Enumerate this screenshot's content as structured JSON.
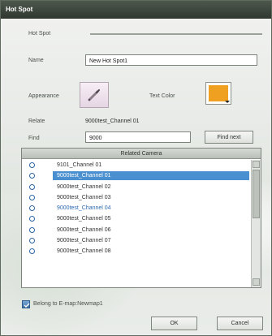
{
  "window": {
    "title": "Hot Spot"
  },
  "form": {
    "hotspot_label": "Hot Spot",
    "name_label": "Name",
    "name_value": "New Hot Spot1",
    "appearance_label": "Appearance",
    "text_color_label": "Text Color",
    "text_color": "#f0a020",
    "relate_label": "Relate",
    "relate_value": "9000test_Channel 01",
    "find_label": "Find",
    "find_value": "9000",
    "find_next_label": "Find next"
  },
  "camera_list": {
    "header": "Related Camera",
    "items": [
      {
        "label": "9101_Channel 01",
        "selected": false,
        "highlighted": false
      },
      {
        "label": "9000test_Channel 01",
        "selected": true,
        "highlighted": false
      },
      {
        "label": "9000test_Channel 02",
        "selected": false,
        "highlighted": false
      },
      {
        "label": "9000test_Channel 03",
        "selected": false,
        "highlighted": false
      },
      {
        "label": "9000test_Channel 04",
        "selected": false,
        "highlighted": true
      },
      {
        "label": "9000test_Channel 05",
        "selected": false,
        "highlighted": false
      },
      {
        "label": "9000test_Channel 06",
        "selected": false,
        "highlighted": false
      },
      {
        "label": "9000test_Channel 07",
        "selected": false,
        "highlighted": false
      },
      {
        "label": "9000test_Channel 08",
        "selected": false,
        "highlighted": false
      }
    ]
  },
  "belong": {
    "label": "Belong to E-map:Newmap1",
    "checked": true
  },
  "buttons": {
    "ok": "OK",
    "cancel": "Cancel"
  }
}
